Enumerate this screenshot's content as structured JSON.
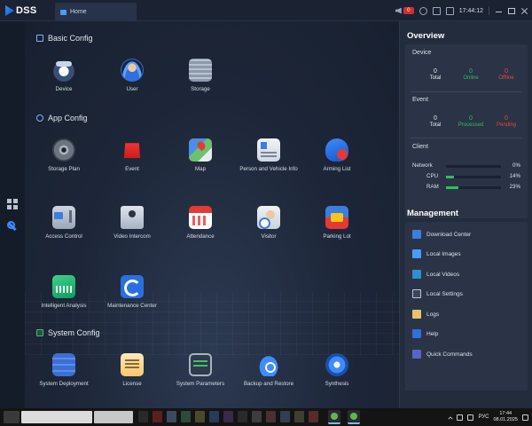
{
  "app": {
    "logo": "DSS",
    "tab": "Home"
  },
  "topbar": {
    "alarm_count": "0",
    "time": "17:44:12"
  },
  "sections": {
    "basic": {
      "title": "Basic Config",
      "items": [
        "Device",
        "User",
        "Storage"
      ]
    },
    "app": {
      "title": "App Config",
      "items": [
        "Storage Plan",
        "Event",
        "Map",
        "Person and Vehicle Info",
        "Arming List",
        "Access Control",
        "Video Intercom",
        "Attendance",
        "Visitor",
        "Parking Lot",
        "Intelligent Analysis",
        "Maintenance Center"
      ]
    },
    "system": {
      "title": "System Config",
      "items": [
        "System Deployment",
        "License",
        "System Parameters",
        "Backup and Restore",
        "Synthesis"
      ]
    }
  },
  "overview": {
    "title": "Overview",
    "device": {
      "title": "Device",
      "total": "0",
      "total_label": "Total",
      "online": "0",
      "online_label": "Online",
      "offline": "0",
      "offline_label": "Offline"
    },
    "event": {
      "title": "Event",
      "total": "0",
      "total_label": "Total",
      "processed": "0",
      "processed_label": "Processed",
      "pending": "0",
      "pending_label": "Pending"
    },
    "client": {
      "title": "Client",
      "rows": [
        {
          "label": "Network",
          "value": "0%",
          "fraction": 0.0
        },
        {
          "label": "CPU",
          "value": "14%",
          "fraction": 0.14
        },
        {
          "label": "RAM",
          "value": "23%",
          "fraction": 0.23
        }
      ]
    }
  },
  "management": {
    "title": "Management",
    "items": [
      "Download Center",
      "Local Images",
      "Local Videos",
      "Local Settings",
      "Logs",
      "Help",
      "Quick Commands"
    ]
  },
  "taskbar": {
    "lang": "РУС",
    "time": "17:44",
    "date": "08.01.2025"
  },
  "colors": {
    "accent": "#3d8bff",
    "ok": "#2fbf5b",
    "bad": "#e5483c",
    "bg": "#1c2433",
    "panel": "#232c3d"
  }
}
